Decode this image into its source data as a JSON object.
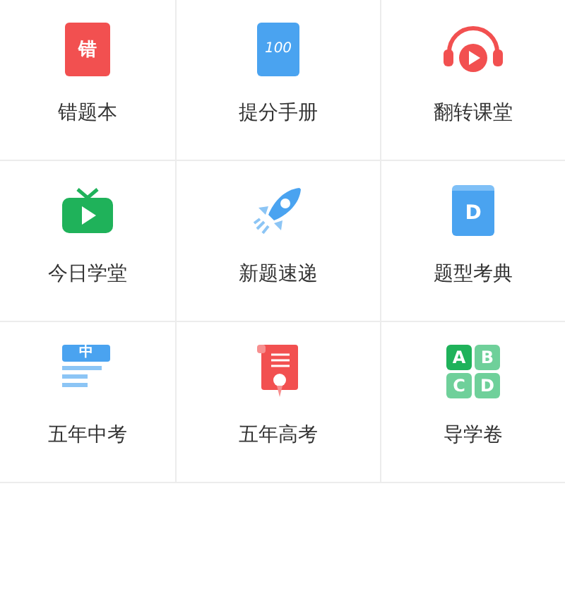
{
  "grid": [
    {
      "label": "错题本",
      "icon": {
        "kind": "red-book",
        "texts": [
          "错"
        ]
      }
    },
    {
      "label": "提分手册",
      "icon": {
        "kind": "blue-notebook",
        "texts": [
          "100"
        ]
      }
    },
    {
      "label": "翻转课堂",
      "icon": {
        "kind": "headphones"
      }
    },
    {
      "label": "今日学堂",
      "icon": {
        "kind": "tv"
      }
    },
    {
      "label": "新题速递",
      "icon": {
        "kind": "rocket"
      }
    },
    {
      "label": "题型考典",
      "icon": {
        "kind": "blue-book",
        "texts": [
          "D"
        ]
      }
    },
    {
      "label": "五年中考",
      "icon": {
        "kind": "doc-pencil",
        "texts": [
          "中"
        ]
      }
    },
    {
      "label": "五年高考",
      "icon": {
        "kind": "certificate"
      }
    },
    {
      "label": "导学卷",
      "icon": {
        "kind": "abcd",
        "texts": [
          "A",
          "B",
          "C",
          "D"
        ]
      }
    }
  ]
}
